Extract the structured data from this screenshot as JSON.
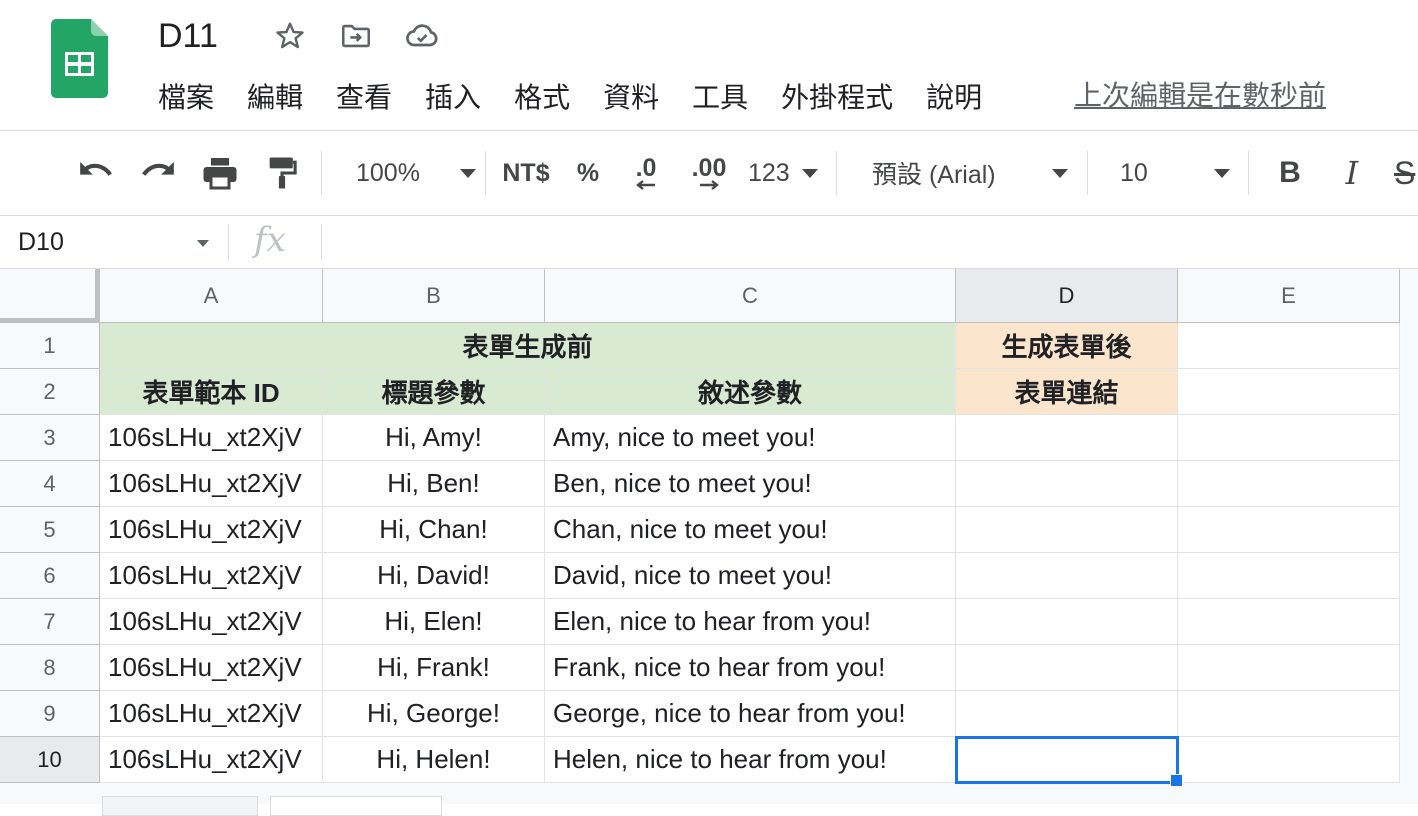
{
  "app": {
    "doc_title": "D11",
    "logo_icon": "google-sheets-logo",
    "title_icons": [
      "star-icon",
      "move-to-folder-icon",
      "cloud-saved-icon"
    ],
    "menu": [
      "檔案",
      "編輯",
      "查看",
      "插入",
      "格式",
      "資料",
      "工具",
      "外掛程式",
      "說明"
    ],
    "last_edit": "上次編輯是在數秒前"
  },
  "toolbar": {
    "zoom": "100%",
    "currency": "NT$",
    "percent": "%",
    "decrease_decimal": ".0",
    "increase_decimal": ".00",
    "more_formats": "123",
    "font": "預設 (Arial)",
    "font_size": "10",
    "bold": "B",
    "italic": "I",
    "strike": "S"
  },
  "formula_bar": {
    "name_box": "D10",
    "fx": "fx",
    "value": ""
  },
  "sheet": {
    "columns": [
      "A",
      "B",
      "C",
      "D",
      "E"
    ],
    "rows": [
      "1",
      "2",
      "3",
      "4",
      "5",
      "6",
      "7",
      "8",
      "9",
      "10"
    ],
    "row1": {
      "merged_a_c": "表單生成前",
      "d": "生成表單後"
    },
    "row2": {
      "a": "表單範本 ID",
      "b": "標題參數",
      "c": "敘述參數",
      "d": "表單連結"
    },
    "data_rows": [
      {
        "a": "106sLHu_xt2XjV",
        "b": "Hi, Amy!",
        "c": "Amy, nice to meet you!",
        "d": ""
      },
      {
        "a": "106sLHu_xt2XjV",
        "b": "Hi, Ben!",
        "c": "Ben, nice to meet you!",
        "d": ""
      },
      {
        "a": "106sLHu_xt2XjV",
        "b": "Hi, Chan!",
        "c": "Chan, nice to meet you!",
        "d": ""
      },
      {
        "a": "106sLHu_xt2XjV",
        "b": "Hi, David!",
        "c": "David, nice to meet you!",
        "d": ""
      },
      {
        "a": "106sLHu_xt2XjV",
        "b": "Hi, Elen!",
        "c": "Elen, nice to hear from you!",
        "d": ""
      },
      {
        "a": "106sLHu_xt2XjV",
        "b": "Hi, Frank!",
        "c": "Frank, nice to hear from you!",
        "d": ""
      },
      {
        "a": "106sLHu_xt2XjV",
        "b": "Hi, George!",
        "c": "George, nice to hear from you!",
        "d": ""
      },
      {
        "a": "106sLHu_xt2XjV",
        "b": "Hi, Helen!",
        "c": "Helen, nice to hear from you!",
        "d": ""
      }
    ],
    "selected_cell": "D10",
    "colors": {
      "green_header": "#d9ead3",
      "peach_header": "#fce5cd",
      "selection": "#1a73e8"
    }
  }
}
